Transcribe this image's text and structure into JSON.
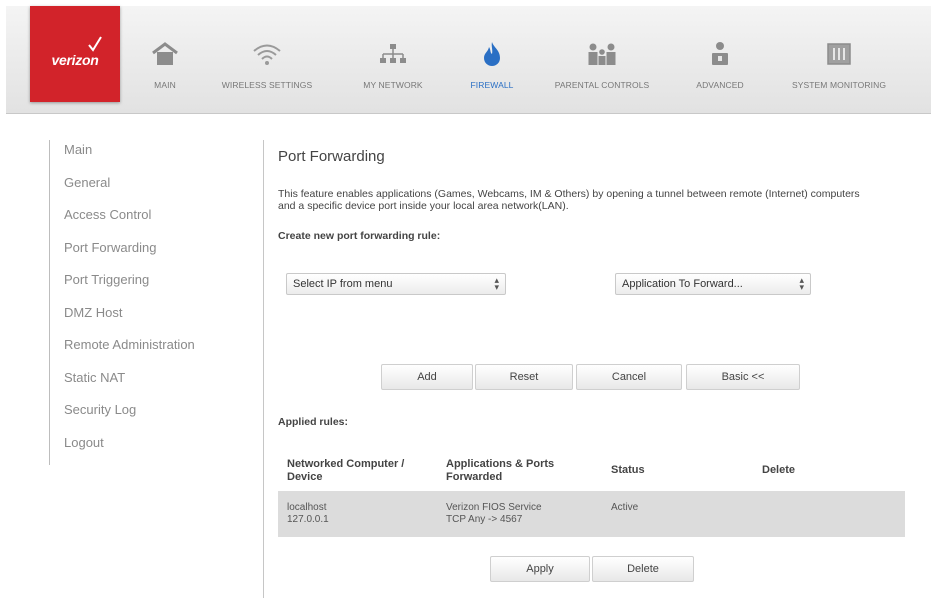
{
  "header": {
    "brand": "verizon",
    "nav": [
      {
        "label": "MAIN",
        "icon": "home-icon"
      },
      {
        "label": "WIRELESS SETTINGS",
        "icon": "wifi-icon"
      },
      {
        "label": "MY NETWORK",
        "icon": "network-icon"
      },
      {
        "label": "FIREWALL",
        "icon": "flame-icon",
        "active": true
      },
      {
        "label": "PARENTAL CONTROLS",
        "icon": "family-icon"
      },
      {
        "label": "ADVANCED",
        "icon": "person-lock-icon"
      },
      {
        "label": "SYSTEM MONITORING",
        "icon": "monitor-icon"
      }
    ],
    "colors": {
      "brand": "#d2232a",
      "active": "#2a6fc4"
    }
  },
  "sidebar": {
    "items": [
      "Main",
      "General",
      "Access Control",
      "Port Forwarding",
      "Port Triggering",
      "DMZ Host",
      "Remote Administration",
      "Static NAT",
      "Security Log",
      "Logout"
    ]
  },
  "main": {
    "title": "Port Forwarding",
    "description": "This feature enables applications (Games, Webcams, IM & Others) by opening a tunnel between remote (Internet) computers and a specific device port inside your local area network(LAN).",
    "create_label": "Create new port forwarding rule:",
    "ip_select": "Select IP from menu",
    "app_select": "Application To Forward...",
    "buttons": {
      "add": "Add",
      "reset": "Reset",
      "cancel": "Cancel",
      "basic": "Basic <<"
    },
    "applied_label": "Applied rules:",
    "table": {
      "headers": [
        "Networked Computer / Device",
        "Applications & Ports Forwarded",
        "Status",
        "Delete"
      ],
      "rows": [
        {
          "device_name": "localhost",
          "device_ip": "127.0.0.1",
          "app_name": "Verizon FIOS Service",
          "app_ports": "TCP Any -> 4567",
          "status": "Active"
        }
      ]
    },
    "bottom_buttons": {
      "apply": "Apply",
      "delete": "Delete"
    }
  }
}
